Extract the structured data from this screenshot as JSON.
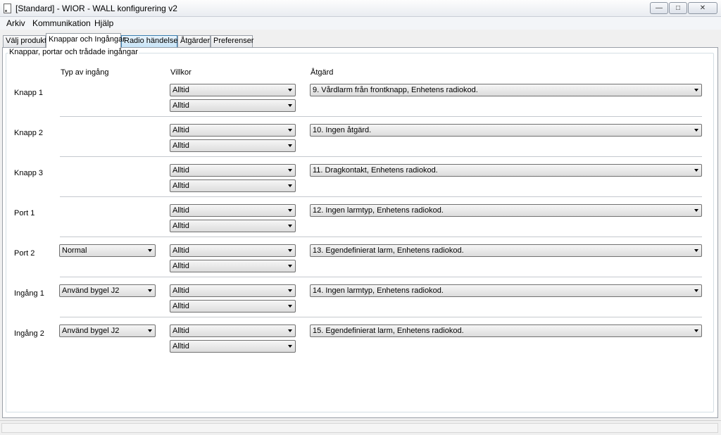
{
  "window": {
    "title": "[Standard] - WIOR - WALL konfigurering v2",
    "minimize": "—",
    "maximize": "□",
    "close": "✕"
  },
  "menu": [
    {
      "label": "Arkiv"
    },
    {
      "label": "Kommunikation"
    },
    {
      "label": "Hjälp"
    }
  ],
  "tabs": [
    {
      "label": "Välj produkt"
    },
    {
      "label": "Knappar och Ingångar"
    },
    {
      "label": "Radio händelser"
    },
    {
      "label": "Åtgärder"
    },
    {
      "label": "Preferenser"
    }
  ],
  "group_title": "Knappar, portar och trådade ingångar",
  "columns": {
    "type": "Typ av ingång",
    "condition": "Villkor",
    "action": "Åtgärd"
  },
  "rows": [
    {
      "label": "Knapp 1",
      "type": "",
      "cond1": "Alltid",
      "cond2": "Alltid",
      "action": "9. Vårdlarm från frontknapp, Enhetens radiokod."
    },
    {
      "label": "Knapp 2",
      "type": "",
      "cond1": "Alltid",
      "cond2": "Alltid",
      "action": "10. Ingen åtgärd."
    },
    {
      "label": "Knapp 3",
      "type": "",
      "cond1": "Alltid",
      "cond2": "Alltid",
      "action": "11. Dragkontakt, Enhetens radiokod."
    },
    {
      "label": "Port 1",
      "type": "",
      "cond1": "Alltid",
      "cond2": "Alltid",
      "action": "12. Ingen larmtyp, Enhetens radiokod."
    },
    {
      "label": "Port 2",
      "type": "Normal",
      "cond1": "Alltid",
      "cond2": "Alltid",
      "action": "13. Egendefinierat larm, Enhetens radiokod."
    },
    {
      "label": "Ingång 1",
      "type": "Använd bygel J2",
      "cond1": "Alltid",
      "cond2": "Alltid",
      "action": "14. Ingen larmtyp, Enhetens radiokod."
    },
    {
      "label": "Ingång 2",
      "type": "Använd bygel J2",
      "cond1": "Alltid",
      "cond2": "Alltid",
      "action": "15. Egendefinierat larm, Enhetens radiokod."
    }
  ]
}
